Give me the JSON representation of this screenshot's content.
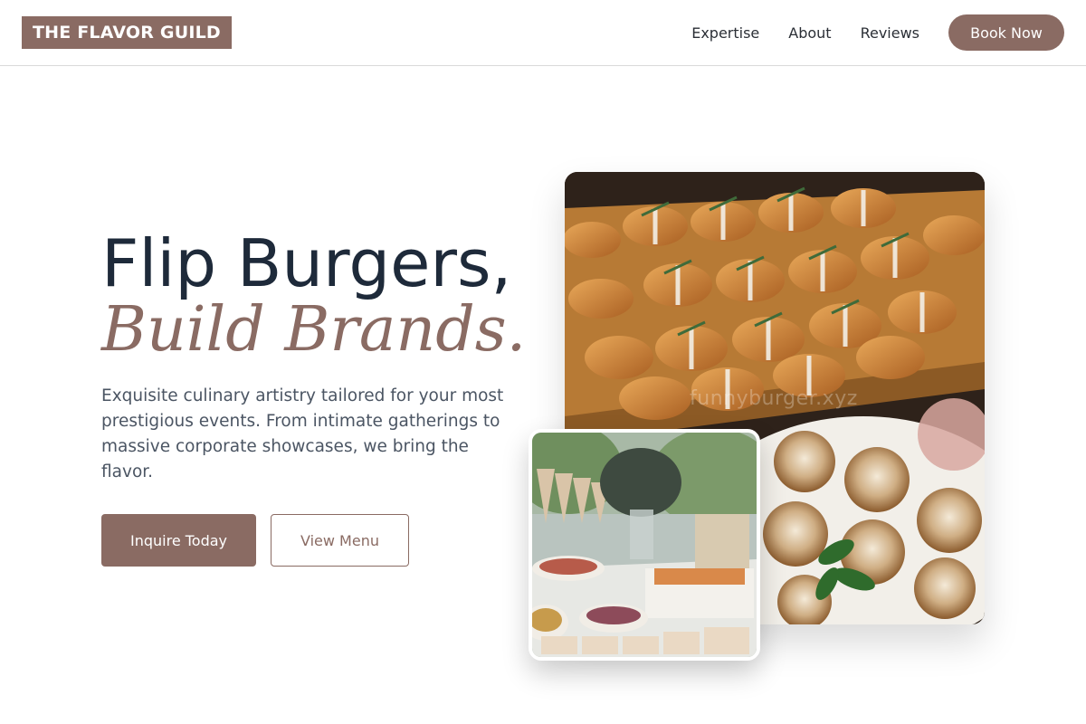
{
  "header": {
    "logo": "THE FLAVOR GUILD",
    "nav": [
      {
        "label": "Expertise"
      },
      {
        "label": "About"
      },
      {
        "label": "Reviews"
      }
    ],
    "cta_label": "Book Now"
  },
  "hero": {
    "title": "Flip Burgers,",
    "subtitle": "Build Brands.",
    "description": "Exquisite culinary artistry tailored for your most prestigious events. From intimate gatherings to massive corporate showcases, we bring the flavor.",
    "primary_button": "Inquire Today",
    "secondary_button": "View Menu"
  },
  "images": {
    "main_watermark": "funnyburger.xyz"
  },
  "colors": {
    "accent": "#8a6b63",
    "heading": "#1e2a3a",
    "body_text": "#4b5563"
  }
}
